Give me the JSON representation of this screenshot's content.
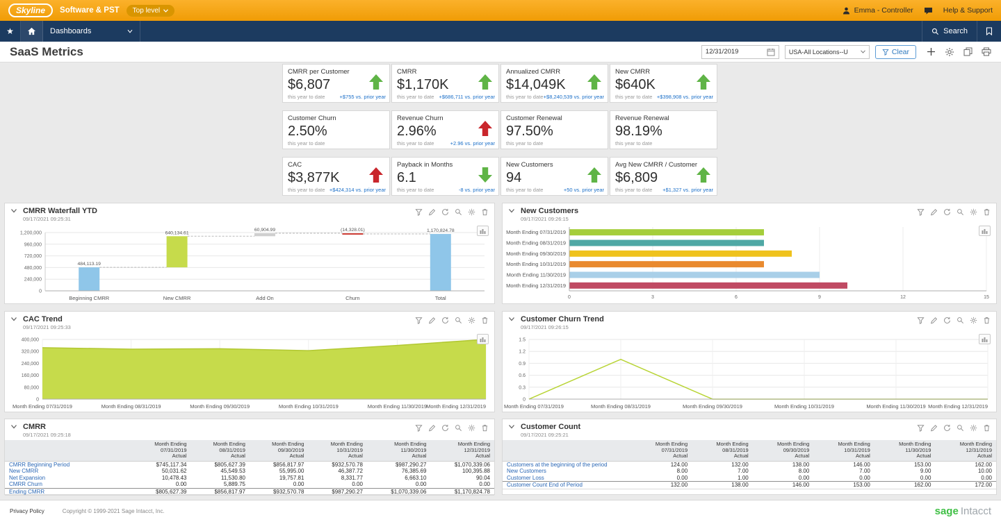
{
  "topbar": {
    "logo_text": "Skyline",
    "company": "Software & PST",
    "entity": "Top level",
    "user": "Emma - Controller",
    "help": "Help & Support"
  },
  "navbar": {
    "dashboards": "Dashboards",
    "search": "Search"
  },
  "pageheader": {
    "title": "SaaS Metrics",
    "date": "12/31/2019",
    "location": "USA-All Locations--U",
    "clear": "Clear"
  },
  "colors": {
    "topbar_orange": "#F5A81C",
    "navbar_navy": "#1C3B60",
    "green_up": "#5FB446",
    "red_alert": "#C9262C",
    "delta_blue": "#1B6FC8",
    "link_blue": "#2A67B5",
    "lime": "#C6DB4B",
    "sky_blue": "#8FC6E9"
  },
  "kpis": [
    {
      "label": "CMRR per Customer",
      "value": "$6,807",
      "period": "this year to date",
      "delta": "+$755 vs. prior year",
      "trend": "up",
      "trend_color": "green"
    },
    {
      "label": "CMRR",
      "value": "$1,170K",
      "period": "this year to date",
      "delta": "+$686,711 vs. prior year",
      "trend": "up",
      "trend_color": "green"
    },
    {
      "label": "Annualized CMRR",
      "value": "$14,049K",
      "period": "this year to date",
      "delta": "+$8,240,539 vs. prior year",
      "trend": "up",
      "trend_color": "green"
    },
    {
      "label": "New CMRR",
      "value": "$640K",
      "period": "this year to date",
      "delta": "+$398,908 vs. prior year",
      "trend": "up",
      "trend_color": "green"
    },
    {
      "label": "Customer Churn",
      "value": "2.50%",
      "period": "this year to date",
      "delta": "",
      "trend": "none",
      "trend_color": ""
    },
    {
      "label": "Revenue Churn",
      "value": "2.96%",
      "period": "this year to date",
      "delta": "+2.96 vs. prior year",
      "trend": "up",
      "trend_color": "red"
    },
    {
      "label": "Customer Renewal",
      "value": "97.50%",
      "period": "this year to date",
      "delta": "",
      "trend": "none",
      "trend_color": ""
    },
    {
      "label": "Revenue Renewal",
      "value": "98.19%",
      "period": "this year to date",
      "delta": "",
      "trend": "none",
      "trend_color": ""
    },
    {
      "label": "CAC",
      "value": "$3,877K",
      "period": "this year to date",
      "delta": "+$424,314 vs. prior year",
      "trend": "up",
      "trend_color": "red"
    },
    {
      "label": "Payback in Months",
      "value": "6.1",
      "period": "this year to date",
      "delta": "-8 vs. prior year",
      "trend": "down",
      "trend_color": "green"
    },
    {
      "label": "New Customers",
      "value": "94",
      "period": "this year to date",
      "delta": "+50 vs. prior year",
      "trend": "up",
      "trend_color": "green"
    },
    {
      "label": "Avg New CMRR / Customer",
      "value": "$6,809",
      "period": "this year to date",
      "delta": "+$1,327 vs. prior year",
      "trend": "up",
      "trend_color": "green"
    }
  ],
  "panels": [
    {
      "id": "waterfall",
      "title": "CMRR Waterfall YTD",
      "timestamp": "09/17/2021 09:25:31"
    },
    {
      "id": "new_customers",
      "title": "New Customers",
      "timestamp": "09/17/2021 09:26:15"
    },
    {
      "id": "cac",
      "title": "CAC Trend",
      "timestamp": "09/17/2021 09:25:33"
    },
    {
      "id": "churn",
      "title": "Customer Churn Trend",
      "timestamp": "09/17/2021 09:26:15"
    },
    {
      "id": "cmrr_table",
      "title": "CMRR",
      "timestamp": "09/17/2021 09:25:18"
    },
    {
      "id": "count_table",
      "title": "Customer Count",
      "timestamp": "09/17/2021 09:25:21"
    }
  ],
  "panel_tools": [
    "filter-icon",
    "edit-icon",
    "refresh-icon",
    "zoom-icon",
    "settings-icon",
    "delete-icon"
  ],
  "header_actions": [
    "add-icon",
    "settings-icon",
    "copy-icon",
    "print-icon"
  ],
  "chart_data": [
    {
      "id": "cmrr_waterfall",
      "type": "bar",
      "subtype": "waterfall",
      "title": "CMRR Waterfall YTD",
      "categories": [
        "Beginning CMRR",
        "New CMRR",
        "Add On",
        "Churn",
        "Total"
      ],
      "values": [
        484113.19,
        640134.61,
        60904.99,
        -14328.01,
        1170824.78
      ],
      "labels": [
        "484,113.19",
        "640,134.61",
        "60,904.99",
        "(14,328.01)",
        "1,170,824.78"
      ],
      "kinds": [
        "total",
        "delta",
        "delta",
        "delta",
        "total"
      ],
      "bar_colors": [
        "#8FC6E9",
        "#C6DB4B",
        "#CFCFCF",
        "#CC3B33",
        "#8FC6E9"
      ],
      "ylim": [
        0,
        1200000
      ],
      "yticks": [
        "0",
        "240,000",
        "480,000",
        "720,000",
        "960,000",
        "1,200,000"
      ]
    },
    {
      "id": "new_customers",
      "type": "bar",
      "orientation": "horizontal",
      "title": "New Customers",
      "categories": [
        "Month Ending 07/31/2019",
        "Month Ending 08/31/2019",
        "Month Ending 09/30/2019",
        "Month Ending 10/31/2019",
        "Month Ending 11/30/2019",
        "Month Ending 12/31/2019"
      ],
      "values": [
        7,
        7,
        8,
        7,
        9,
        10
      ],
      "bar_colors": [
        "#A5CE3B",
        "#4FA8A5",
        "#EFC21C",
        "#E98A2F",
        "#A9CFE8",
        "#C04A63"
      ],
      "xlim": [
        0,
        15
      ],
      "xticks": [
        0,
        3,
        6,
        9,
        12,
        15
      ]
    },
    {
      "id": "cac_trend",
      "type": "area",
      "title": "CAC Trend",
      "categories": [
        "Month Ending 07/31/2019",
        "Month Ending 08/31/2019",
        "Month Ending 09/30/2019",
        "Month Ending 10/31/2019",
        "Month Ending 11/30/2019",
        "Month Ending 12/31/2019"
      ],
      "values": [
        345000,
        335000,
        338000,
        325000,
        360000,
        400000
      ],
      "ylim": [
        0,
        400000
      ],
      "yticks": [
        "0",
        "80,000",
        "160,000",
        "240,000",
        "320,000",
        "400,000"
      ],
      "color": "#C6DB4B",
      "line_color": "#B2C832"
    },
    {
      "id": "churn_trend",
      "type": "line",
      "title": "Customer Churn Trend",
      "categories": [
        "Month Ending 07/31/2019",
        "Month Ending 08/31/2019",
        "Month Ending 09/30/2019",
        "Month Ending 10/31/2019",
        "Month Ending 11/30/2019",
        "Month Ending 12/31/2019"
      ],
      "values": [
        0,
        1,
        0,
        0,
        0,
        0
      ],
      "ylim": [
        0,
        1.5
      ],
      "yticks": [
        "0",
        "0.3",
        "0.6",
        "0.9",
        "1.2",
        "1.5"
      ],
      "color": "#B8D435"
    },
    {
      "id": "cmrr_table",
      "type": "table",
      "title": "CMRR",
      "col_header_top": "Month Ending",
      "col_dates": [
        "07/31/2019",
        "08/31/2019",
        "09/30/2019",
        "10/31/2019",
        "11/30/2019",
        "12/31/2019"
      ],
      "col_sub": "Actual",
      "rows": [
        {
          "label": "CMRR Beginning Period",
          "values": [
            "$745,117.34",
            "$805,627.39",
            "$856,817.97",
            "$932,570.78",
            "$987,290.27",
            "$1,070,339.06"
          ]
        },
        {
          "label": "New CMRR",
          "values": [
            "50,031.62",
            "45,549.53",
            "55,995.00",
            "46,387.72",
            "76,385.69",
            "100,395.88"
          ]
        },
        {
          "label": "Net Expansion",
          "values": [
            "10,478.43",
            "11,530.80",
            "19,757.81",
            "8,331.77",
            "6,663.10",
            "90.04"
          ]
        },
        {
          "label": "CMRR Churn",
          "values": [
            "0.00",
            "5,889.75",
            "0.00",
            "0.00",
            "0.00",
            "0.00"
          ]
        },
        {
          "label": "Ending CMRR",
          "values": [
            "$805,627.39",
            "$856,817.97",
            "$932,570.78",
            "$987,290.27",
            "$1,070,339.06",
            "$1,170,824.78"
          ]
        }
      ]
    },
    {
      "id": "customer_count_table",
      "type": "table",
      "title": "Customer Count",
      "col_header_top": "Month Ending",
      "col_dates": [
        "07/31/2019",
        "08/31/2019",
        "09/30/2019",
        "10/31/2019",
        "11/30/2019",
        "12/31/2019"
      ],
      "col_sub": "Actual",
      "rows": [
        {
          "label": "Customers at the beginning of the period",
          "values": [
            "124.00",
            "132.00",
            "138.00",
            "146.00",
            "153.00",
            "162.00"
          ]
        },
        {
          "label": "New Customers",
          "values": [
            "8.00",
            "7.00",
            "8.00",
            "7.00",
            "9.00",
            "10.00"
          ]
        },
        {
          "label": "Customer Loss",
          "values": [
            "0.00",
            "1.00",
            "0.00",
            "0.00",
            "0.00",
            "0.00"
          ]
        },
        {
          "label": "Customer Count End of Period",
          "values": [
            "132.00",
            "138.00",
            "146.00",
            "153.00",
            "162.00",
            "172.00"
          ]
        }
      ]
    }
  ],
  "footer": {
    "privacy": "Privacy Policy",
    "copyright": "Copyright © 1999-2021 Sage Intacct, Inc.",
    "brand_sage": "sage",
    "brand_intacct": "Intacct"
  }
}
